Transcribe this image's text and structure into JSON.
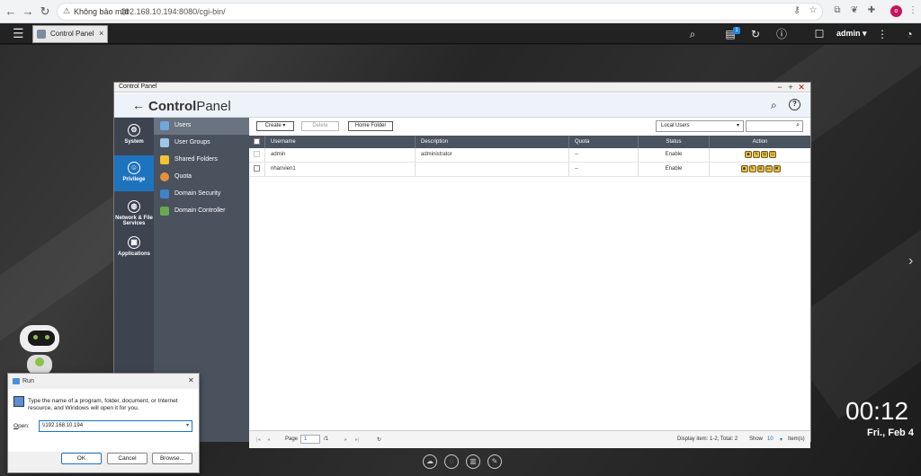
{
  "browser": {
    "security_label": "Không bảo mật",
    "url": "192.168.10.194:8080/cgi-bin/",
    "profile_initial": "o"
  },
  "nas_bar": {
    "tab_label": "Control Panel",
    "tab_close": "×",
    "notification_badge": "1",
    "user": "admin ▾"
  },
  "desktop": {
    "clock": "00:12",
    "date": "Fri., Feb 4"
  },
  "control_panel": {
    "window_title": "Control Panel",
    "brand_bold": "Control",
    "brand_rest": "Panel",
    "categories": [
      {
        "label": "System",
        "icon": "gear-icon"
      },
      {
        "label": "Privilege",
        "icon": "user-icon"
      },
      {
        "label": "Network & File Services",
        "icon": "globe-icon"
      },
      {
        "label": "Applications",
        "icon": "apps-icon"
      }
    ],
    "subnav": [
      {
        "label": "Users",
        "color": "#6fa8dc"
      },
      {
        "label": "User Groups",
        "color": "#9fc5e8"
      },
      {
        "label": "Shared Folders",
        "color": "#f1c232"
      },
      {
        "label": "Quota",
        "color": "#e69138"
      },
      {
        "label": "Domain Security",
        "color": "#3d85c6"
      },
      {
        "label": "Domain Controller",
        "color": "#6aa84f"
      }
    ],
    "toolbar": {
      "create": "Create ▾",
      "delete": "Delete",
      "home_folder": "Home Folder",
      "user_type": "Local Users",
      "search_placeholder": ""
    },
    "table": {
      "columns": [
        "Username",
        "Description",
        "Quota",
        "Status",
        "Action"
      ],
      "rows": [
        {
          "username": "admin",
          "description": "administrator",
          "quota": "--",
          "status": "Enable"
        },
        {
          "username": "nhanvien1",
          "description": "",
          "quota": "--",
          "status": "Enable"
        }
      ]
    },
    "pager": {
      "page_label": "Page",
      "page": "1",
      "of": "/1",
      "display": "Display item: 1-2, Total: 2",
      "show_label": "Show",
      "show_value": "10",
      "items_label": "Item(s)"
    }
  },
  "run_dialog": {
    "title": "Run",
    "description": "Type the name of a program, folder, document, or Internet resource, and Windows will open it for you.",
    "open_label": "pen:",
    "open_underline": "O",
    "input_value": "\\\\192.168.10.194",
    "ok": "OK",
    "cancel": "Cancel",
    "browse": "Browse..."
  }
}
